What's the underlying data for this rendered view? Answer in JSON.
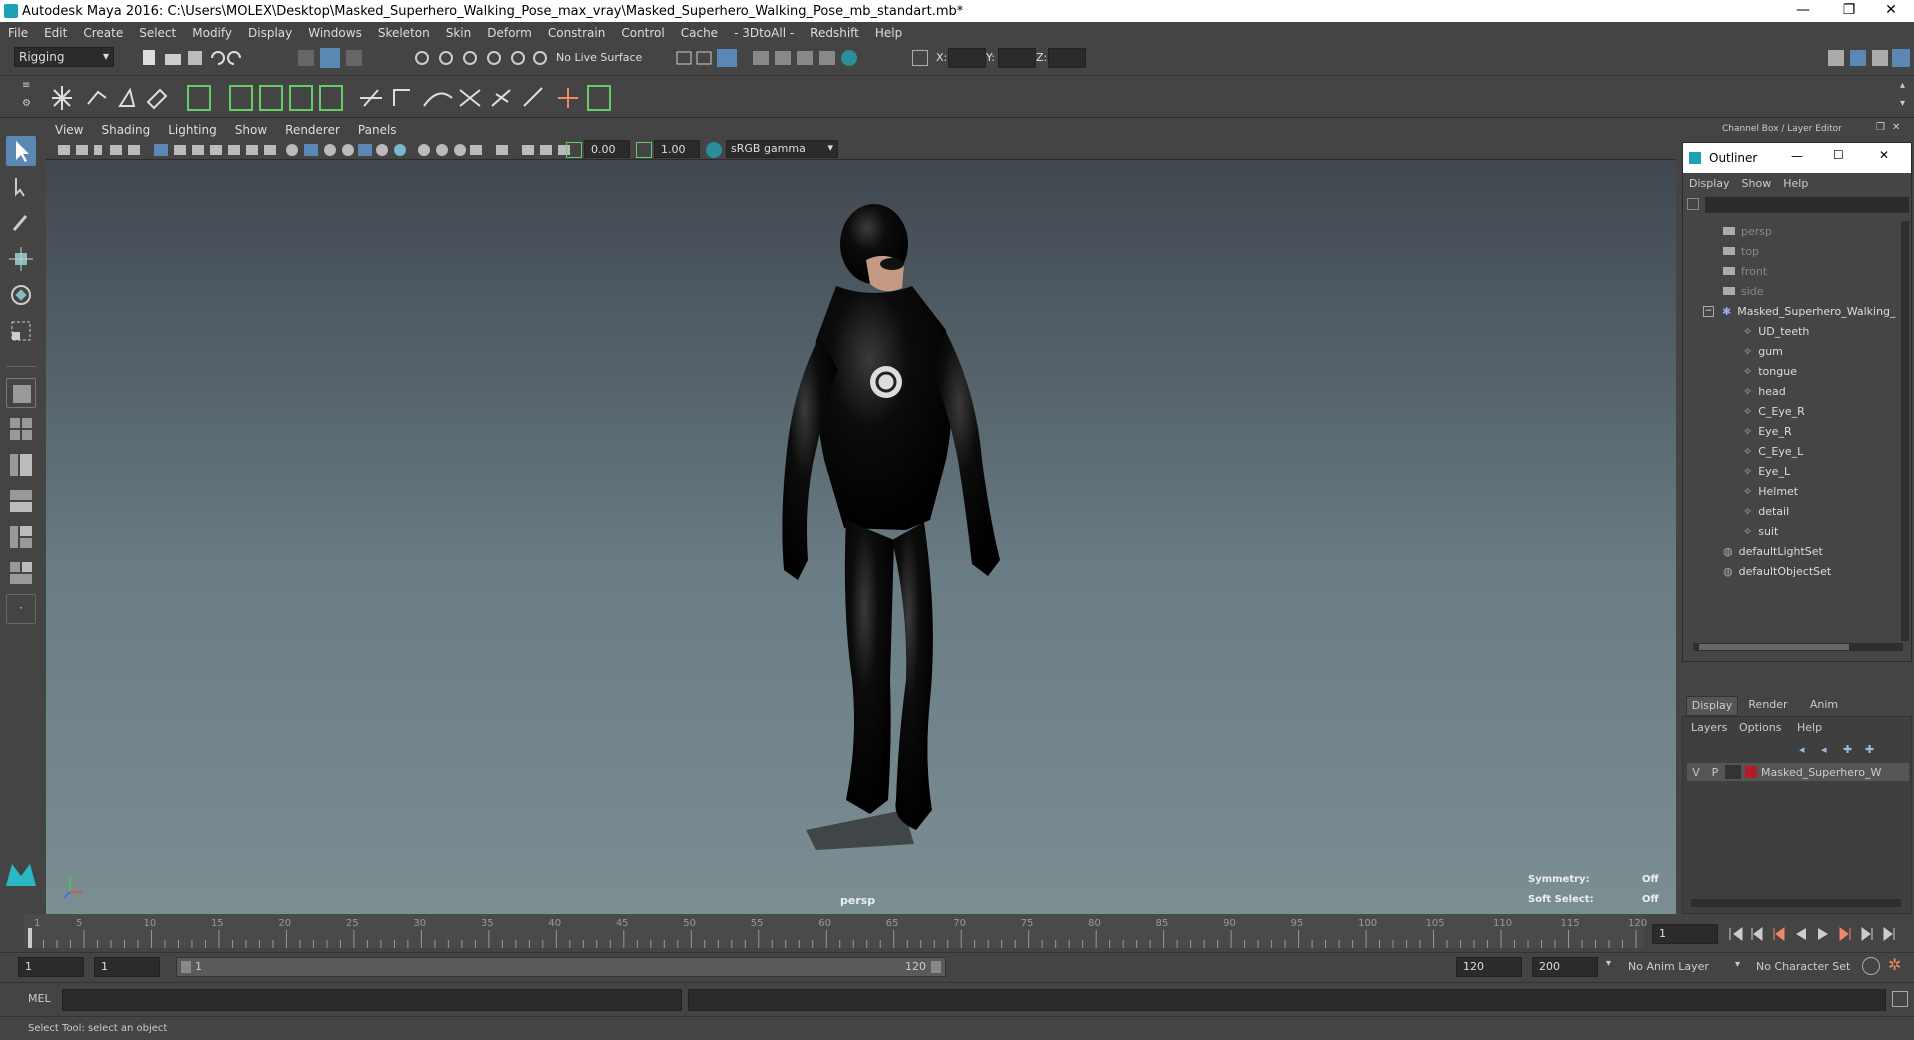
{
  "window": {
    "title": "Autodesk Maya 2016: C:\\Users\\MOLEX\\Desktop\\Masked_Superhero_Walking_Pose_max_vray\\Masked_Superhero_Walking_Pose_mb_standart.mb*",
    "minimize": "—",
    "maximize": "❐",
    "close": "✕"
  },
  "menubar": [
    "File",
    "Edit",
    "Create",
    "Select",
    "Modify",
    "Display",
    "Windows",
    "Skeleton",
    "Skin",
    "Deform",
    "Constrain",
    "Control",
    "Cache",
    "- 3DtoAll -",
    "Redshift",
    "Help"
  ],
  "statusline": {
    "menu_set": "Rigging",
    "live_surface": "No Live Surface",
    "x_label": "X:",
    "y_label": "Y:",
    "z_label": "Z:"
  },
  "viewport": {
    "menu": [
      "View",
      "Shading",
      "Lighting",
      "Show",
      "Renderer",
      "Panels"
    ],
    "exposure": "0.00",
    "gamma": "1.00",
    "color_space": "sRGB gamma",
    "camera_label": "persp",
    "symmetry_label": "Symmetry:",
    "symmetry_value": "Off",
    "soft_select_label": "Soft Select:",
    "soft_select_value": "Off"
  },
  "right_panel": {
    "title": "Channel Box / Layer Editor"
  },
  "outliner": {
    "title": "Outliner",
    "menu": [
      "Display",
      "Show",
      "Help"
    ],
    "cameras": [
      "persp",
      "top",
      "front",
      "side"
    ],
    "group": "Masked_Superhero_Walking_",
    "children": [
      "UD_teeth",
      "gum",
      "tongue",
      "head",
      "C_Eye_R",
      "Eye_R",
      "C_Eye_L",
      "Eye_L",
      "Helmet",
      "detail",
      "suit"
    ],
    "sets": [
      "defaultLightSet",
      "defaultObjectSet"
    ]
  },
  "layer_editor": {
    "tabs": [
      "Display",
      "Render",
      "Anim"
    ],
    "menu": [
      "Layers",
      "Options",
      "Help"
    ],
    "layer_v": "V",
    "layer_p": "P",
    "layer_name": "Masked_Superhero_W",
    "layer_color": "#b01a2a"
  },
  "timeline": {
    "ticks": [
      "1",
      "5",
      "10",
      "15",
      "20",
      "25",
      "30",
      "35",
      "40",
      "45",
      "50",
      "55",
      "60",
      "65",
      "70",
      "75",
      "80",
      "85",
      "90",
      "95",
      "100",
      "105",
      "110",
      "115",
      "120"
    ],
    "current_frame": "1"
  },
  "range": {
    "start": "1",
    "anim_start": "1",
    "slider_start": "1",
    "slider_end": "120",
    "anim_end": "120",
    "end": "200",
    "anim_layer": "No Anim Layer",
    "character_set": "No Character Set"
  },
  "cmdline": {
    "label": "MEL"
  },
  "helpline": {
    "text": "Select Tool: select an object"
  }
}
